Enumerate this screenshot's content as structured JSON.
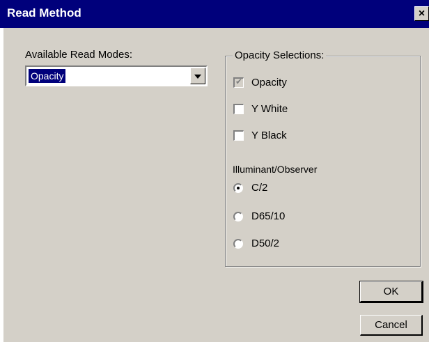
{
  "window": {
    "title": "Read Method",
    "close_glyph": "×"
  },
  "read_modes": {
    "label": "Available Read Modes:",
    "selected": "Opacity"
  },
  "opacity_group": {
    "legend": "Opacity Selections:",
    "checkboxes": [
      {
        "label": "Opacity",
        "checked": true,
        "disabled": true
      },
      {
        "label": "Y White",
        "checked": false,
        "disabled": false
      },
      {
        "label": "Y Black",
        "checked": false,
        "disabled": false
      }
    ],
    "illuminant_label": "Illuminant/Observer",
    "radios": [
      {
        "label": "C/2",
        "selected": true
      },
      {
        "label": "D65/10",
        "selected": false
      },
      {
        "label": "D50/2",
        "selected": false
      }
    ]
  },
  "buttons": {
    "ok": "OK",
    "cancel": "Cancel"
  },
  "colors": {
    "titlebar": "#00007b",
    "face": "#d4d0c8",
    "highlight": "#00007b"
  }
}
